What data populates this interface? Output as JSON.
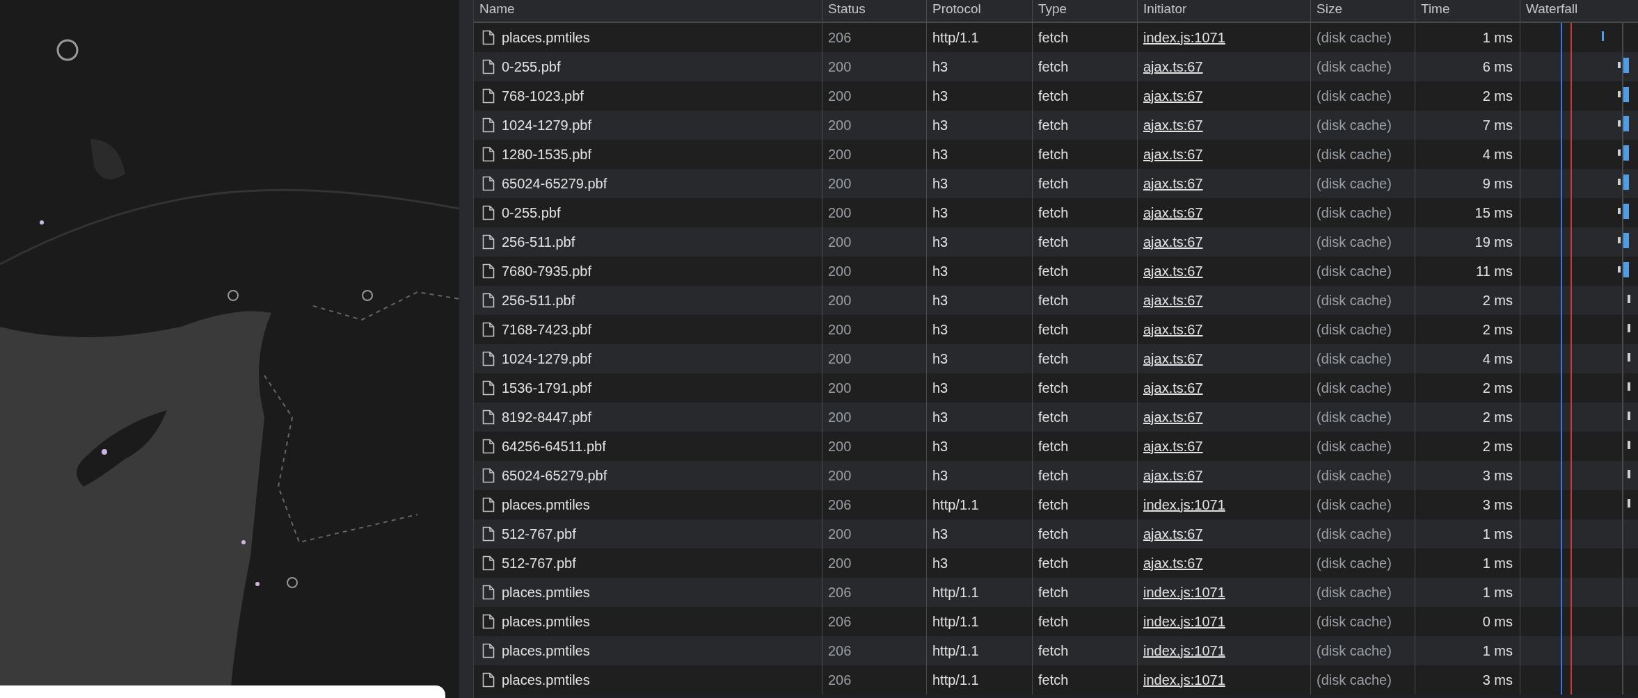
{
  "table": {
    "columns": [
      "Name",
      "Status",
      "Protocol",
      "Type",
      "Initiator",
      "Size",
      "Time",
      "Waterfall"
    ],
    "rows": [
      {
        "name": "places.pmtiles",
        "status": "206",
        "protocol": "http/1.1",
        "type": "fetch",
        "initiator": "index.js:1071",
        "size": "(disk cache)",
        "time": "1 ms",
        "kind": "early"
      },
      {
        "name": "0-255.pbf",
        "status": "200",
        "protocol": "h3",
        "type": "fetch",
        "initiator": "ajax.ts:67",
        "size": "(disk cache)",
        "time": "6 ms",
        "kind": "bar"
      },
      {
        "name": "768-1023.pbf",
        "status": "200",
        "protocol": "h3",
        "type": "fetch",
        "initiator": "ajax.ts:67",
        "size": "(disk cache)",
        "time": "2 ms",
        "kind": "bar"
      },
      {
        "name": "1024-1279.pbf",
        "status": "200",
        "protocol": "h3",
        "type": "fetch",
        "initiator": "ajax.ts:67",
        "size": "(disk cache)",
        "time": "7 ms",
        "kind": "bar"
      },
      {
        "name": "1280-1535.pbf",
        "status": "200",
        "protocol": "h3",
        "type": "fetch",
        "initiator": "ajax.ts:67",
        "size": "(disk cache)",
        "time": "4 ms",
        "kind": "bar"
      },
      {
        "name": "65024-65279.pbf",
        "status": "200",
        "protocol": "h3",
        "type": "fetch",
        "initiator": "ajax.ts:67",
        "size": "(disk cache)",
        "time": "9 ms",
        "kind": "bar"
      },
      {
        "name": "0-255.pbf",
        "status": "200",
        "protocol": "h3",
        "type": "fetch",
        "initiator": "ajax.ts:67",
        "size": "(disk cache)",
        "time": "15 ms",
        "kind": "bar"
      },
      {
        "name": "256-511.pbf",
        "status": "200",
        "protocol": "h3",
        "type": "fetch",
        "initiator": "ajax.ts:67",
        "size": "(disk cache)",
        "time": "19 ms",
        "kind": "bar"
      },
      {
        "name": "7680-7935.pbf",
        "status": "200",
        "protocol": "h3",
        "type": "fetch",
        "initiator": "ajax.ts:67",
        "size": "(disk cache)",
        "time": "11 ms",
        "kind": "bar"
      },
      {
        "name": "256-511.pbf",
        "status": "200",
        "protocol": "h3",
        "type": "fetch",
        "initiator": "ajax.ts:67",
        "size": "(disk cache)",
        "time": "2 ms",
        "kind": "tick"
      },
      {
        "name": "7168-7423.pbf",
        "status": "200",
        "protocol": "h3",
        "type": "fetch",
        "initiator": "ajax.ts:67",
        "size": "(disk cache)",
        "time": "2 ms",
        "kind": "tick"
      },
      {
        "name": "1024-1279.pbf",
        "status": "200",
        "protocol": "h3",
        "type": "fetch",
        "initiator": "ajax.ts:67",
        "size": "(disk cache)",
        "time": "4 ms",
        "kind": "tick"
      },
      {
        "name": "1536-1791.pbf",
        "status": "200",
        "protocol": "h3",
        "type": "fetch",
        "initiator": "ajax.ts:67",
        "size": "(disk cache)",
        "time": "2 ms",
        "kind": "tick"
      },
      {
        "name": "8192-8447.pbf",
        "status": "200",
        "protocol": "h3",
        "type": "fetch",
        "initiator": "ajax.ts:67",
        "size": "(disk cache)",
        "time": "2 ms",
        "kind": "tick"
      },
      {
        "name": "64256-64511.pbf",
        "status": "200",
        "protocol": "h3",
        "type": "fetch",
        "initiator": "ajax.ts:67",
        "size": "(disk cache)",
        "time": "2 ms",
        "kind": "tick"
      },
      {
        "name": "65024-65279.pbf",
        "status": "200",
        "protocol": "h3",
        "type": "fetch",
        "initiator": "ajax.ts:67",
        "size": "(disk cache)",
        "time": "3 ms",
        "kind": "tick"
      },
      {
        "name": "places.pmtiles",
        "status": "206",
        "protocol": "http/1.1",
        "type": "fetch",
        "initiator": "index.js:1071",
        "size": "(disk cache)",
        "time": "3 ms",
        "kind": "tick"
      },
      {
        "name": "512-767.pbf",
        "status": "200",
        "protocol": "h3",
        "type": "fetch",
        "initiator": "ajax.ts:67",
        "size": "(disk cache)",
        "time": "1 ms"
      },
      {
        "name": "512-767.pbf",
        "status": "200",
        "protocol": "h3",
        "type": "fetch",
        "initiator": "ajax.ts:67",
        "size": "(disk cache)",
        "time": "1 ms"
      },
      {
        "name": "places.pmtiles",
        "status": "206",
        "protocol": "http/1.1",
        "type": "fetch",
        "initiator": "index.js:1071",
        "size": "(disk cache)",
        "time": "1 ms"
      },
      {
        "name": "places.pmtiles",
        "status": "206",
        "protocol": "http/1.1",
        "type": "fetch",
        "initiator": "index.js:1071",
        "size": "(disk cache)",
        "time": "0 ms"
      },
      {
        "name": "places.pmtiles",
        "status": "206",
        "protocol": "http/1.1",
        "type": "fetch",
        "initiator": "index.js:1071",
        "size": "(disk cache)",
        "time": "1 ms"
      },
      {
        "name": "places.pmtiles",
        "status": "206",
        "protocol": "http/1.1",
        "type": "fetch",
        "initiator": "index.js:1071",
        "size": "(disk cache)",
        "time": "3 ms"
      }
    ]
  }
}
